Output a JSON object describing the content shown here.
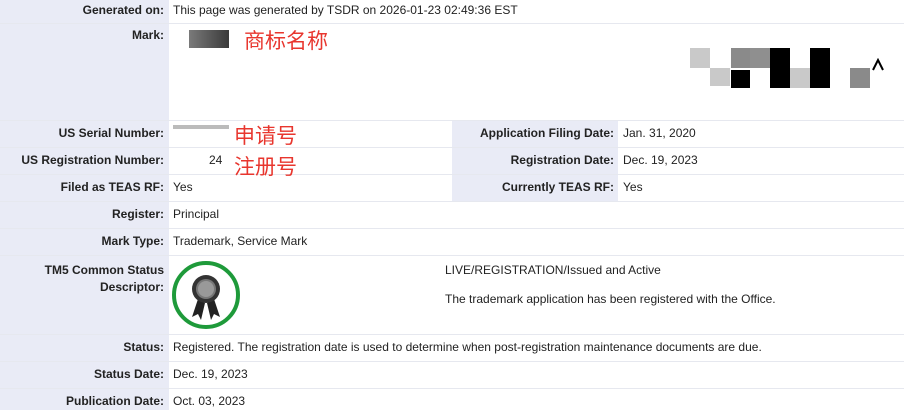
{
  "generated": {
    "label": "Generated on:",
    "value": "This page was generated by TSDR on 2026-01-23 02:49:36 EST"
  },
  "mark": {
    "label": "Mark:",
    "annotation": "商标名称"
  },
  "serial": {
    "label": "US Serial Number:",
    "value": "",
    "annotation": "申请号"
  },
  "filing_date": {
    "label": "Application Filing Date:",
    "value": "Jan. 31, 2020"
  },
  "registration_number": {
    "label": "US Registration Number:",
    "value": "24",
    "annotation": "注册号"
  },
  "registration_date": {
    "label": "Registration Date:",
    "value": "Dec. 19, 2023"
  },
  "teas_rf": {
    "label": "Filed as TEAS RF:",
    "value": "Yes"
  },
  "current_teas_rf": {
    "label": "Currently TEAS RF:",
    "value": "Yes"
  },
  "register": {
    "label": "Register:",
    "value": "Principal"
  },
  "mark_type": {
    "label": "Mark Type:",
    "value": "Trademark, Service Mark"
  },
  "tm5": {
    "label_line1": "TM5 Common Status",
    "label_line2": "Descriptor:",
    "status_title": "LIVE/REGISTRATION/Issued and Active",
    "status_desc": "The trademark application has been registered with the Office.",
    "badge_color": "#1e9a3a"
  },
  "status": {
    "label": "Status:",
    "value": "Registered. The registration date is used to determine when post-registration maintenance documents are due."
  },
  "status_date": {
    "label": "Status Date:",
    "value": "Dec. 19, 2023"
  },
  "publication_date": {
    "label": "Publication Date:",
    "value": "Oct. 03, 2023"
  },
  "colors": {
    "label_bg": "#e9ebf6",
    "annotation": "#e8362e"
  }
}
